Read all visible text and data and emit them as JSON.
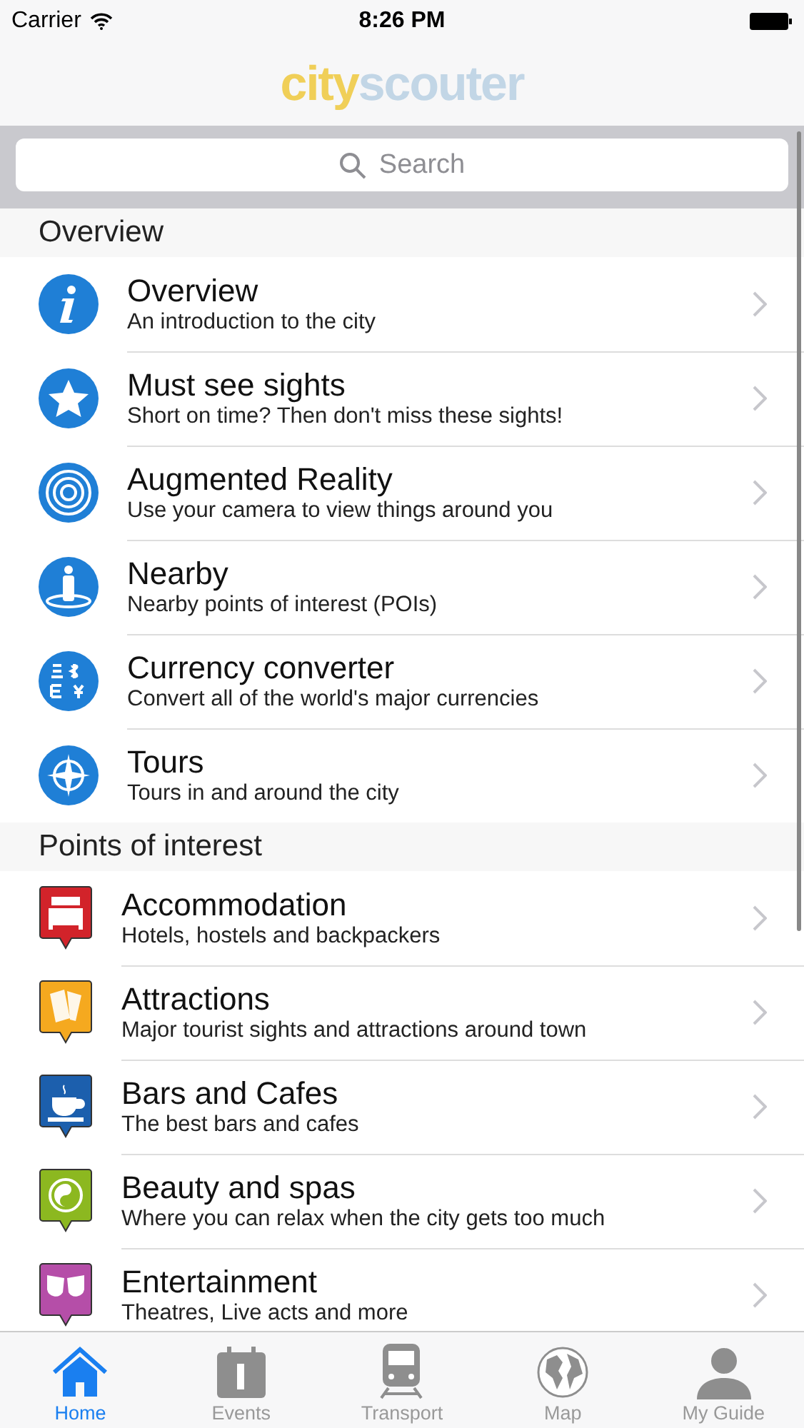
{
  "status_bar": {
    "carrier": "Carrier",
    "time": "8:26 PM"
  },
  "logo": {
    "part_1": "city",
    "part_2": "scouter"
  },
  "search": {
    "placeholder": "Search"
  },
  "sections": [
    {
      "title": "Overview",
      "items": [
        {
          "title": "Overview",
          "subtitle": "An introduction to the city"
        },
        {
          "title": "Must see sights",
          "subtitle": "Short on time? Then don't miss these sights!"
        },
        {
          "title": "Augmented Reality",
          "subtitle": "Use your camera to view things around you"
        },
        {
          "title": "Nearby",
          "subtitle": "Nearby points of interest (POIs)"
        },
        {
          "title": "Currency converter",
          "subtitle": "Convert all of the world's major currencies"
        },
        {
          "title": "Tours",
          "subtitle": "Tours in and around the city"
        }
      ]
    },
    {
      "title": "Points of interest",
      "items": [
        {
          "title": "Accommodation",
          "subtitle": "Hotels, hostels and backpackers"
        },
        {
          "title": "Attractions",
          "subtitle": "Major tourist sights and attractions around town"
        },
        {
          "title": "Bars and Cafes",
          "subtitle": "The best bars and cafes"
        },
        {
          "title": "Beauty and spas",
          "subtitle": "Where you can relax when the city gets too much"
        },
        {
          "title": "Entertainment",
          "subtitle": "Theatres, Live acts and more"
        }
      ]
    }
  ],
  "tabs": [
    {
      "label": "Home",
      "selected": true
    },
    {
      "label": "Events",
      "selected": false
    },
    {
      "label": "Transport",
      "selected": false
    },
    {
      "label": "Map",
      "selected": false
    },
    {
      "label": "My Guide",
      "selected": false
    }
  ]
}
